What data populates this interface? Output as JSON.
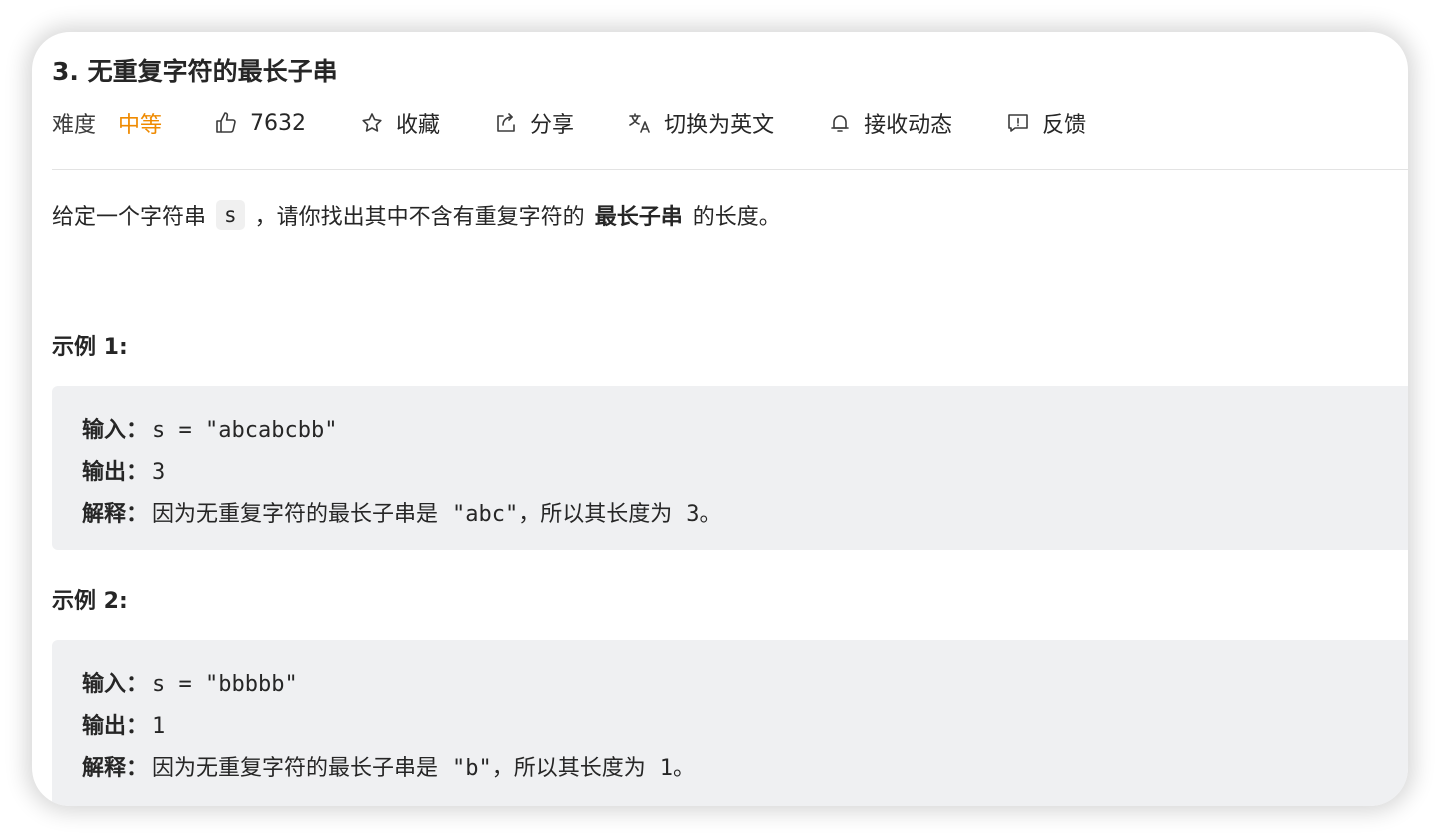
{
  "problem": {
    "title": "3. 无重复字符的最长子串"
  },
  "toolbar": {
    "difficulty_label": "难度",
    "difficulty_value": "中等",
    "difficulty_color": "#ef8a00",
    "like_icon": "thumbs-up-icon",
    "like_count": "7632",
    "favorite_icon": "star-icon",
    "favorite_label": "收藏",
    "share_icon": "share-icon",
    "share_label": "分享",
    "translate_icon": "translate-icon",
    "translate_label": "切换为英文",
    "notify_icon": "bell-icon",
    "notify_label": "接收动态",
    "feedback_icon": "feedback-icon",
    "feedback_label": "反馈"
  },
  "description": {
    "prefix": "给定一个字符串",
    "code": "s",
    "middle": "，请你找出其中不含有重复字符的",
    "bold": "最长子串",
    "suffix": "的长度。"
  },
  "examples": [
    {
      "title": "示例 1:",
      "input_key": "输入：",
      "input_value": "s = \"abcabcbb\"",
      "output_key": "输出：",
      "output_value": "3",
      "explain_key": "解释：",
      "explain_prefix": "因为无重复字符的最长子串是",
      "explain_code": "\"abc\"",
      "explain_middle": "，所以其长度为",
      "explain_code2": "3",
      "explain_end": "。"
    },
    {
      "title": "示例 2:",
      "input_key": "输入：",
      "input_value": "s = \"bbbbb\"",
      "output_key": "输出：",
      "output_value": "1",
      "explain_key": "解释：",
      "explain_prefix": "因为无重复字符的最长子串是",
      "explain_code": "\"b\"",
      "explain_middle": "，所以其长度为",
      "explain_code2": "1",
      "explain_end": "。"
    }
  ]
}
